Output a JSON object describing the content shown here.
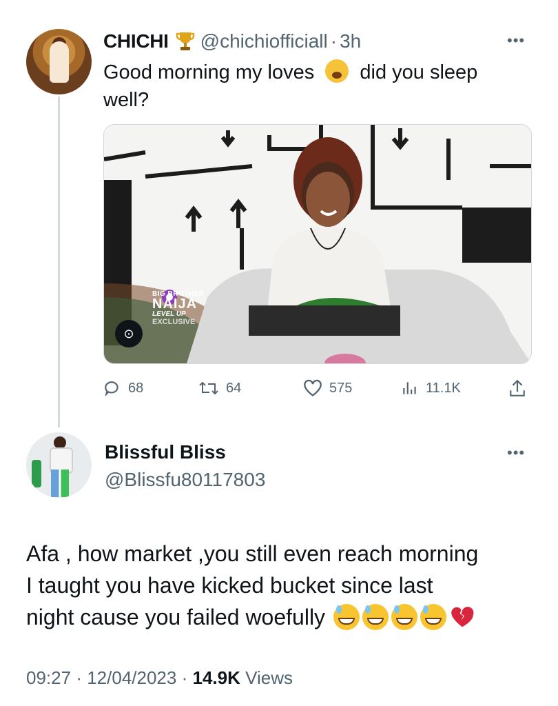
{
  "tweet": {
    "author_name": "CHICHI",
    "handle": "@chichiofficiall",
    "separator": "·",
    "time": "3h",
    "text_line1": "Good morning my loves",
    "text_line1b": "did you sleep",
    "text_line2": "well?",
    "media": {
      "logo_small": "BIG BROTHER",
      "logo_main": "NAIJA",
      "logo_sub": "LEVEL UP",
      "logo_tag": "EXCLUSIVE"
    },
    "actions": {
      "replies": "68",
      "retweets": "64",
      "likes": "575",
      "views": "11.1K"
    }
  },
  "reply": {
    "author_name": "Blissful Bliss",
    "handle": "@Blissfu80117803",
    "text_line1": "Afa , how market ,you still even reach morning",
    "text_line2": "I taught you have kicked bucket since last",
    "text_line3": "night cause you failed woefully",
    "footer_time": "09:27",
    "footer_sep1": "·",
    "footer_date": "12/04/2023",
    "footer_sep2": "·",
    "footer_views_count": "14.9K",
    "footer_views_label": "Views"
  },
  "icons": {
    "more": "more-options-icon",
    "reply": "reply-icon",
    "retweet": "retweet-icon",
    "like": "heart-icon",
    "views": "views-icon",
    "share": "share-icon",
    "verified_trophy": "trophy-icon"
  },
  "colors": {
    "text": "#0f1419",
    "secondary": "#536471",
    "thread_line": "#cfd9de"
  }
}
